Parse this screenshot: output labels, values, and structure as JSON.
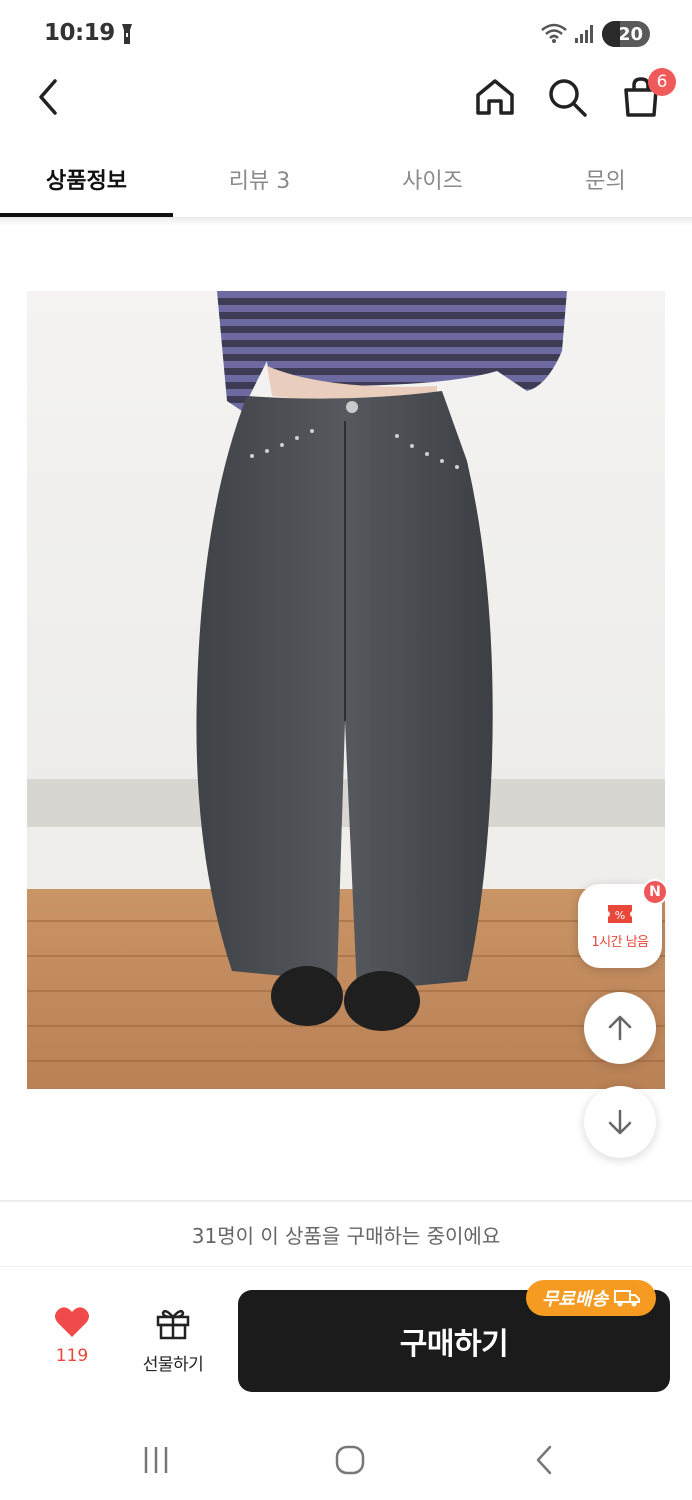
{
  "status_bar": {
    "time": "10:19",
    "battery": "20"
  },
  "header": {
    "back_icon": "chevron-left-icon",
    "home_icon": "home-icon",
    "search_icon": "search-icon",
    "cart_icon": "shopping-bag-icon",
    "cart_count": "6"
  },
  "tabs": [
    {
      "label": "상품정보",
      "active": true
    },
    {
      "label": "리뷰 3",
      "active": false
    },
    {
      "label": "사이즈",
      "active": false
    },
    {
      "label": "문의",
      "active": false
    }
  ],
  "floating": {
    "coupon_label": "1시간 남음",
    "coupon_badge": "N",
    "scroll_up_icon": "arrow-up-icon",
    "scroll_down_icon": "arrow-down-icon"
  },
  "purchase_notice": "31명이 이 상품을 구매하는 중이에요",
  "bottom_bar": {
    "like_count": "119",
    "gift_label": "선물하기",
    "buy_label": "구매하기",
    "shipping_badge": "무료배송"
  },
  "colors": {
    "accent_red": "#e8473a",
    "buy_button": "#1b1b1b",
    "shipping_orange": "#f59b21"
  }
}
